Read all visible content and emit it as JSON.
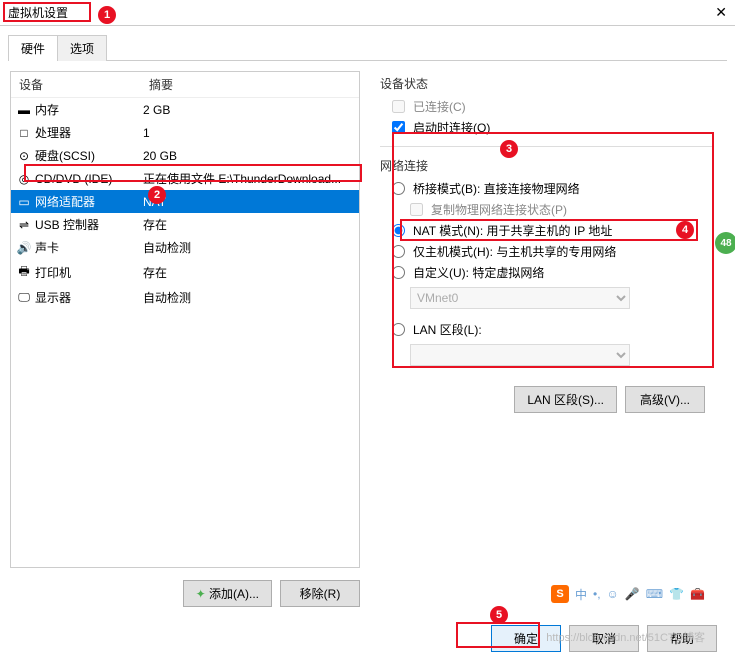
{
  "window": {
    "title": "虚拟机设置"
  },
  "tabs": {
    "hardware": "硬件",
    "options": "选项"
  },
  "hw_header": {
    "device": "设备",
    "summary": "摘要"
  },
  "hw": [
    {
      "icon": "▬",
      "name": "内存",
      "summary": "2 GB"
    },
    {
      "icon": "□",
      "name": "处理器",
      "summary": "1"
    },
    {
      "icon": "⊙",
      "name": "硬盘(SCSI)",
      "summary": "20 GB"
    },
    {
      "icon": "◎",
      "name": "CD/DVD (IDE)",
      "summary": "正在使用文件 E:\\ThunderDownload..."
    },
    {
      "icon": "▭",
      "name": "网络适配器",
      "summary": "NAT"
    },
    {
      "icon": "⇌",
      "name": "USB 控制器",
      "summary": "存在"
    },
    {
      "icon": "🔊",
      "name": "声卡",
      "summary": "自动检测"
    },
    {
      "icon": "🖶",
      "name": "打印机",
      "summary": "存在"
    },
    {
      "icon": "🖵",
      "name": "显示器",
      "summary": "自动检测"
    }
  ],
  "left_buttons": {
    "add": "添加(A)...",
    "add_icon": "✦",
    "remove": "移除(R)"
  },
  "status": {
    "group": "设备状态",
    "connected": "已连接(C)",
    "connect_on_power": "启动时连接(O)"
  },
  "net": {
    "group": "网络连接",
    "bridged": "桥接模式(B): 直接连接物理网络",
    "replicate": "复制物理网络连接状态(P)",
    "nat": "NAT 模式(N): 用于共享主机的 IP 地址",
    "hostonly": "仅主机模式(H): 与主机共享的专用网络",
    "custom": "自定义(U): 特定虚拟网络",
    "custom_value": "VMnet0",
    "lan": "LAN 区段(L):",
    "lan_value": ""
  },
  "right_buttons": {
    "lan_segments": "LAN 区段(S)...",
    "advanced": "高级(V)..."
  },
  "bottom": {
    "ok": "确定",
    "cancel": "取消",
    "help": "帮助"
  },
  "ime": {
    "zhong": "中",
    "dot": "•,",
    "smile": "☺"
  },
  "watermark": "https://blog.csdn.net/51CTO博客",
  "green": "48"
}
